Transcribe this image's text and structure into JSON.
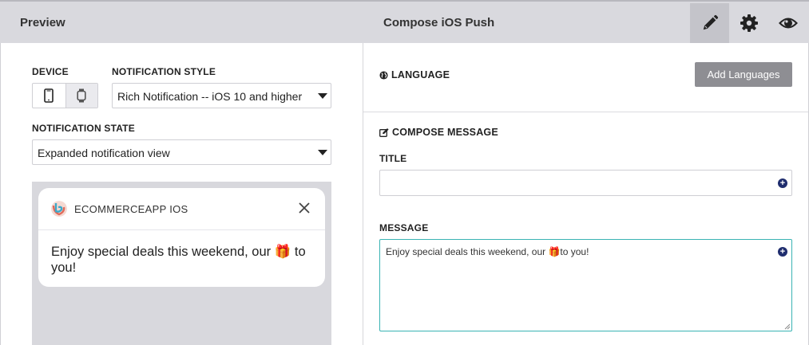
{
  "header": {
    "left_title": "Preview",
    "title": "Compose iOS Push",
    "icons": [
      "pencil-icon",
      "gear-icon",
      "eye-icon"
    ]
  },
  "left": {
    "device_label": "DEVICE",
    "devices": [
      "phone-icon",
      "watch-icon"
    ],
    "style_label": "NOTIFICATION STYLE",
    "style_value": "Rich Notification -- iOS 10 and higher",
    "state_label": "NOTIFICATION STATE",
    "state_value": "Expanded notification view",
    "notification": {
      "app_name": "ECOMMERCEAPP IOS",
      "body": "Enjoy special deals this weekend, our 🎁 to you!"
    }
  },
  "right": {
    "language_heading": "LANGUAGE",
    "add_languages_label": "Add Languages",
    "compose_heading": "COMPOSE MESSAGE",
    "title_label": "TITLE",
    "title_value": "",
    "message_label": "MESSAGE",
    "message_value": "Enjoy special deals this weekend, our 🎁to you!"
  },
  "colors": {
    "header_bg": "#d9d9de",
    "active_tab": "#c4c4ca",
    "focus_border": "#39b3b3",
    "button_gray": "#8e8e93",
    "plus_navy": "#1f2d6e"
  }
}
